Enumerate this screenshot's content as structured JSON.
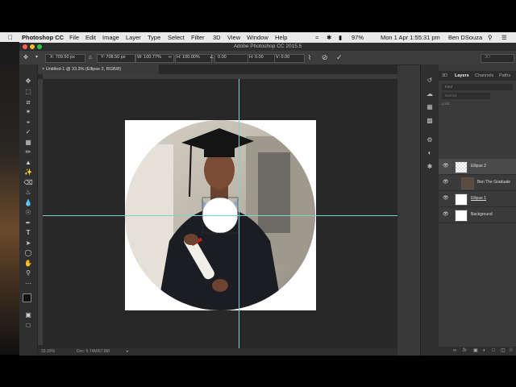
{
  "menubar": {
    "app_name": "Photoshop CC",
    "items": [
      "File",
      "Edit",
      "Image",
      "Layer",
      "Type",
      "Select",
      "Filter",
      "3D",
      "View",
      "Window",
      "Help"
    ],
    "battery": "97%",
    "datetime": "Mon 1 Apr  1:55:31 pm",
    "user": "Ben DSouza"
  },
  "window": {
    "title": "Adobe Photoshop CC 2015.5"
  },
  "options": {
    "x": "X: 709.50 px",
    "y": "Y: 708.50 px",
    "w": "W: 100.77%",
    "h": "H: 100.00%",
    "angle": "0.00",
    "hskew": "H: 0.00",
    "vskew": "V: 0.00",
    "workspace": "3D"
  },
  "document": {
    "tab": "Untitled-1 @ 33.3% (Ellipse 2, RGB/8)",
    "zoom": "33.33%",
    "doc_size": "Doc: 5.74M/67.8M"
  },
  "panel": {
    "tabs": [
      "3D",
      "Layers",
      "Channels",
      "Paths"
    ],
    "kind": "Kind",
    "blend": "Normal",
    "lock": "Lock:",
    "layers": [
      {
        "name": "Ellipse 2"
      },
      {
        "name": "Ben The Graduate"
      },
      {
        "name": "Ellipse 1"
      },
      {
        "name": "Background"
      }
    ]
  },
  "colors": {
    "accent": "#7fd0d0",
    "panel": "#3a3a3a",
    "canvas_bg": "#282828"
  }
}
